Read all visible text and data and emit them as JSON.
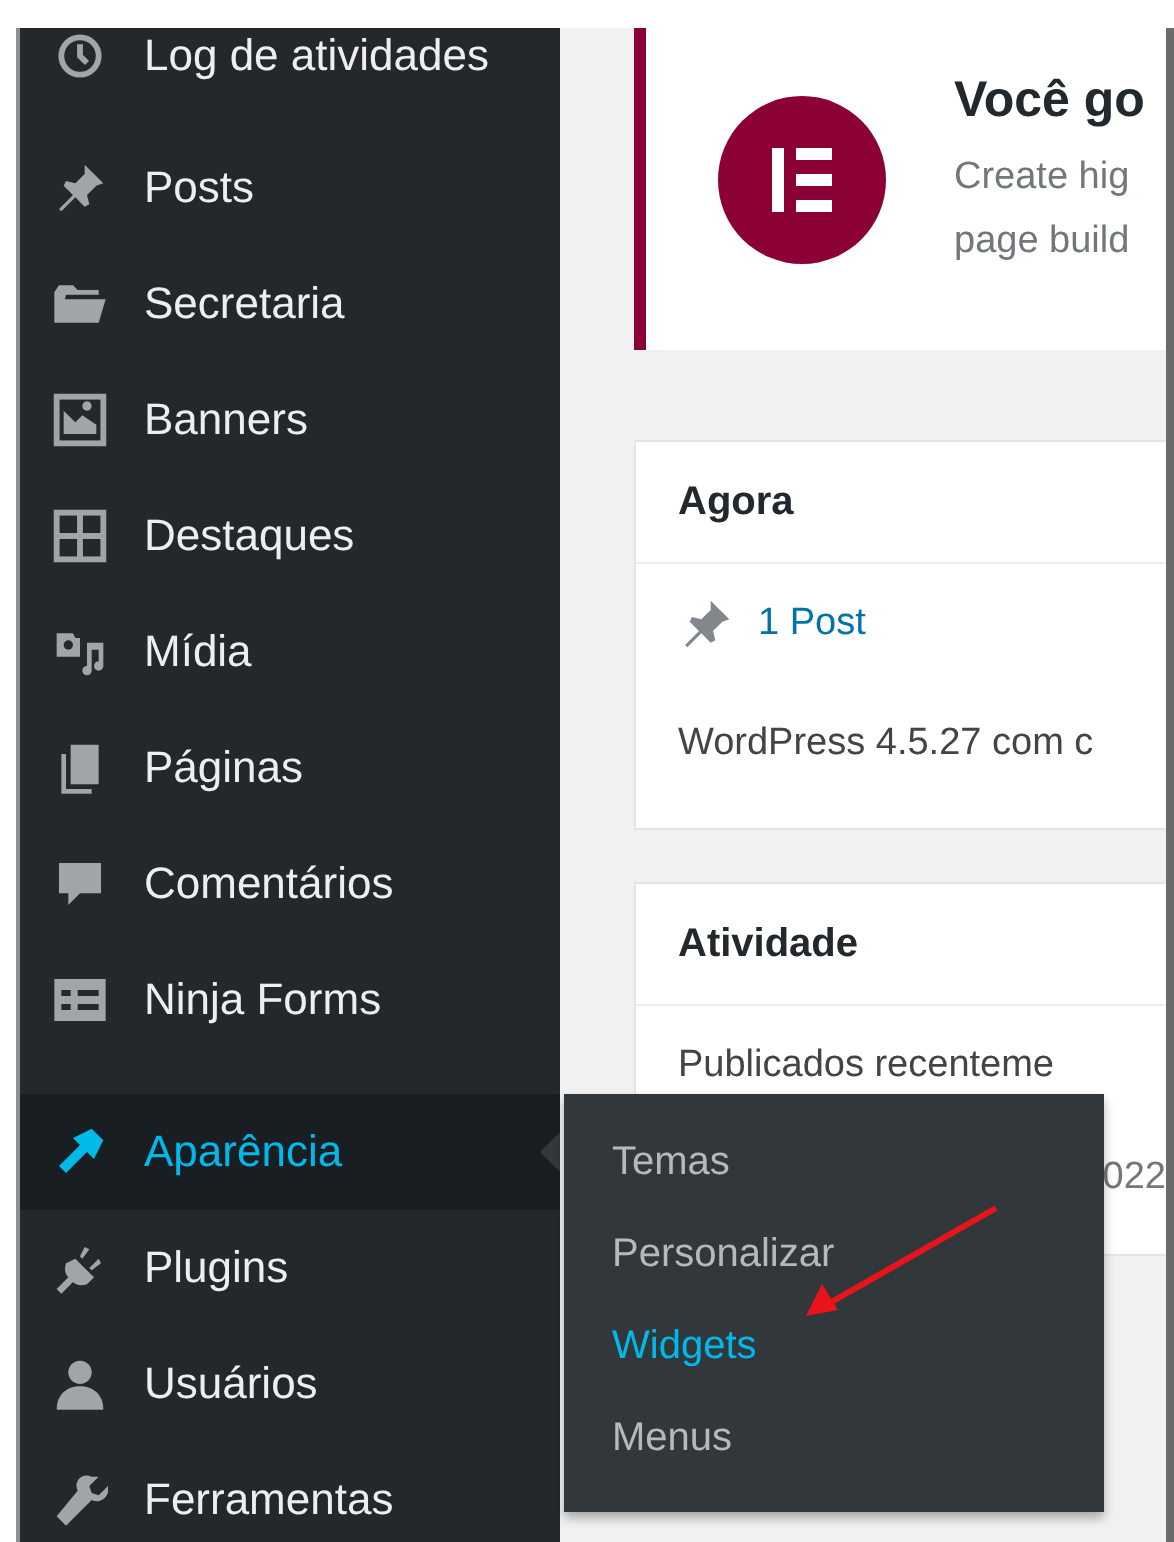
{
  "sidebar": {
    "groups": [
      {
        "items": [
          {
            "label": "Log de atividades",
            "selected": false
          }
        ]
      },
      {
        "items": [
          {
            "label": "Posts",
            "selected": false
          },
          {
            "label": "Secretaria",
            "selected": false
          },
          {
            "label": "Banners",
            "selected": false
          },
          {
            "label": "Destaques",
            "selected": false
          },
          {
            "label": "Mídia",
            "selected": false
          },
          {
            "label": "Páginas",
            "selected": false
          },
          {
            "label": "Comentários",
            "selected": false
          },
          {
            "label": "Ninja Forms",
            "selected": false
          }
        ]
      },
      {
        "items": [
          {
            "label": "Aparência",
            "selected": true
          },
          {
            "label": "Plugins",
            "selected": false
          },
          {
            "label": "Usuários",
            "selected": false
          },
          {
            "label": "Ferramentas",
            "selected": false
          }
        ]
      }
    ]
  },
  "flyout": {
    "items": [
      {
        "label": "Temas",
        "selected": false
      },
      {
        "label": "Personalizar",
        "selected": false
      },
      {
        "label": "Widgets",
        "selected": true
      },
      {
        "label": "Menus",
        "selected": false
      }
    ]
  },
  "notice": {
    "title": "Você go",
    "lines": [
      "Create hig",
      "page build"
    ]
  },
  "widgets": [
    {
      "title": "Agora",
      "rows": [
        {
          "kind": "link",
          "text": "1 Post"
        },
        {
          "kind": "text",
          "text": "WordPress 4.5.27 com c"
        }
      ]
    },
    {
      "title": "Atividade",
      "rows": [
        {
          "kind": "text",
          "text": "Publicados recenteme"
        },
        {
          "kind": "trailing",
          "text": "022"
        }
      ]
    }
  ]
}
